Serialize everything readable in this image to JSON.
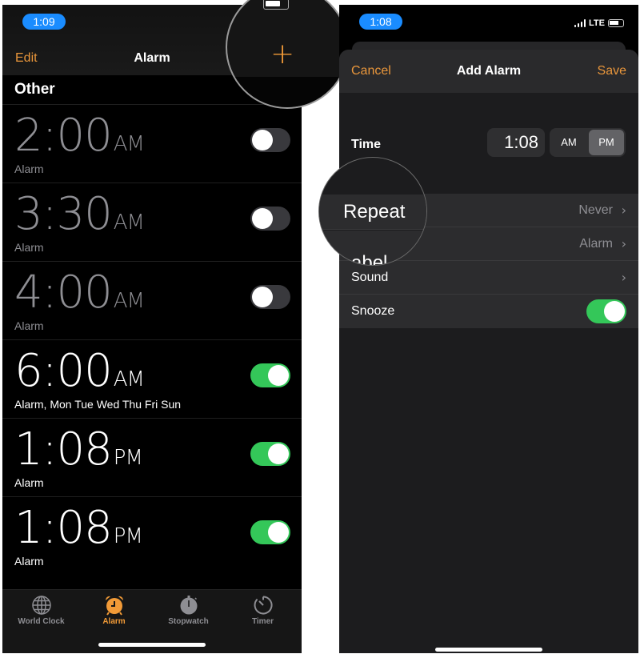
{
  "left": {
    "status_time": "1:09",
    "nav": {
      "edit": "Edit",
      "title": "Alarm",
      "add_icon": "plus-icon"
    },
    "section_title": "Other",
    "alarms": [
      {
        "time": "2:00",
        "period": "AM",
        "label": "Alarm",
        "enabled": false
      },
      {
        "time": "3:30",
        "period": "AM",
        "label": "Alarm",
        "enabled": false
      },
      {
        "time": "4:00",
        "period": "AM",
        "label": "Alarm",
        "enabled": false
      },
      {
        "time": "6:00",
        "period": "AM",
        "label": "Alarm, Mon Tue Wed Thu Fri Sun",
        "enabled": true
      },
      {
        "time": "1:08",
        "period": "PM",
        "label": "Alarm",
        "enabled": true
      },
      {
        "time": "1:08",
        "period": "PM",
        "label": "Alarm",
        "enabled": true
      }
    ],
    "tabs": [
      {
        "label": "World Clock",
        "icon": "globe-icon",
        "active": false
      },
      {
        "label": "Alarm",
        "icon": "alarm-clock-icon",
        "active": true
      },
      {
        "label": "Stopwatch",
        "icon": "stopwatch-icon",
        "active": false
      },
      {
        "label": "Timer",
        "icon": "timer-icon",
        "active": false
      }
    ]
  },
  "right": {
    "status_time": "1:08",
    "network": "LTE",
    "nav": {
      "cancel": "Cancel",
      "title": "Add Alarm",
      "save": "Save"
    },
    "time_label": "Time",
    "time_value": "1:08",
    "period_options": [
      "AM",
      "PM"
    ],
    "period_selected": "PM",
    "rows": [
      {
        "label": "Repeat",
        "value": "Never",
        "type": "link"
      },
      {
        "label": "Label",
        "value": "Alarm",
        "type": "link"
      },
      {
        "label": "Sound",
        "value": "",
        "type": "link"
      },
      {
        "label": "Snooze",
        "value": "",
        "type": "toggle",
        "enabled": true
      }
    ],
    "magnifier_text": "Repeat",
    "magnifier_partial": "abel"
  },
  "colors": {
    "accent": "#e9963b",
    "toggle_on": "#34c759",
    "toggle_off": "#39393d",
    "status_pill": "#1a8cff"
  }
}
